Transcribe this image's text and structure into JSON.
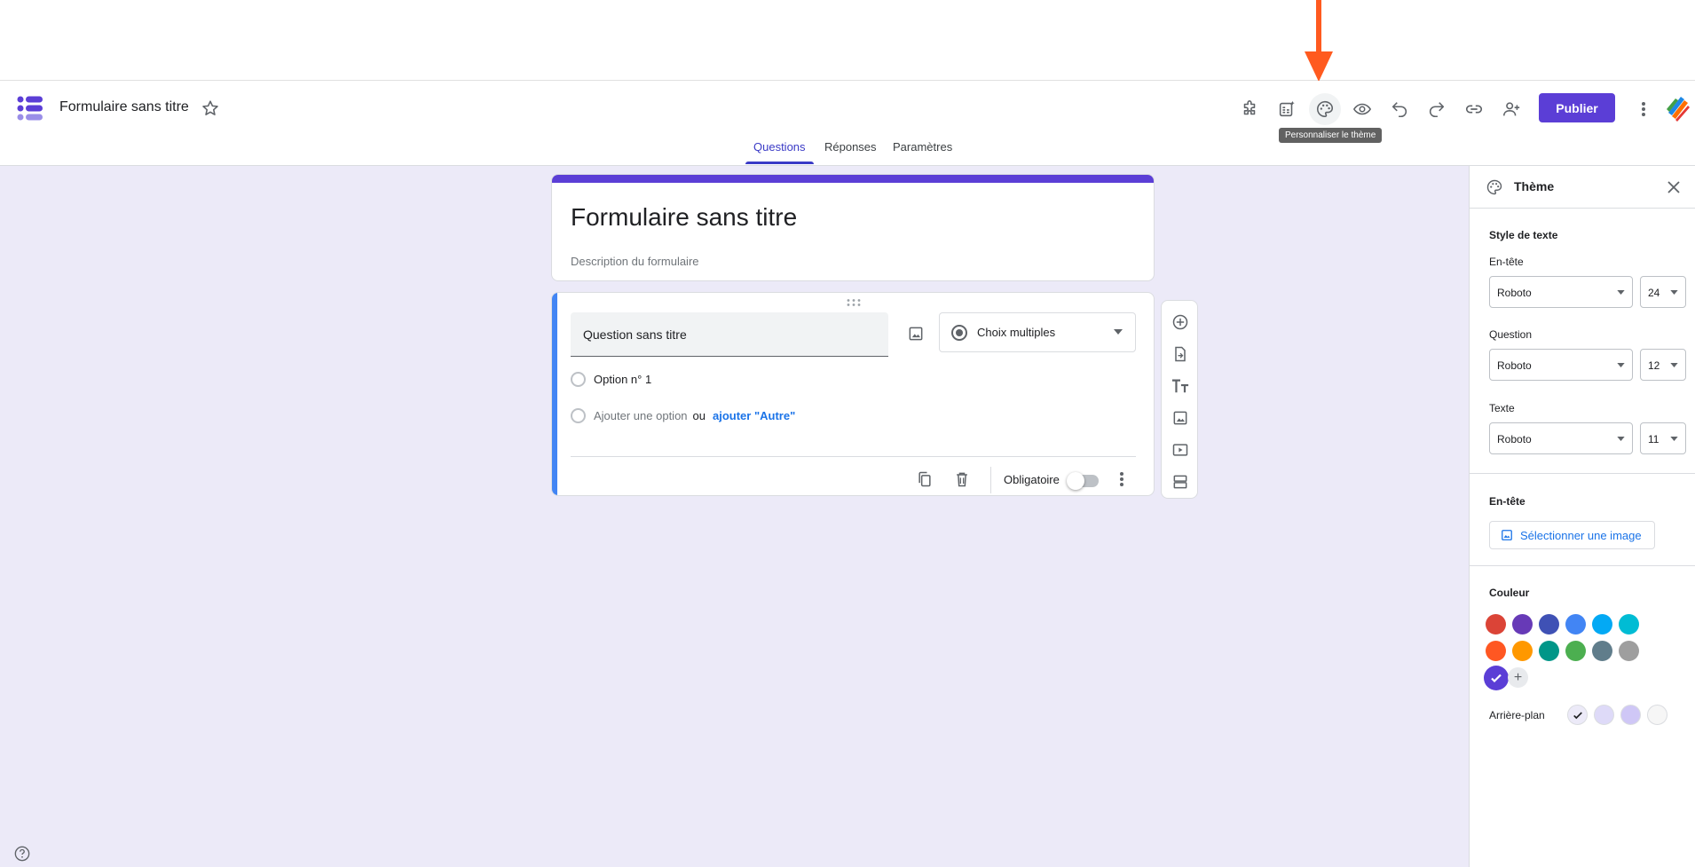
{
  "header": {
    "doc_title": "Formulaire sans titre",
    "tooltip": "Personnaliser le thème",
    "publish_label": "Publier",
    "tabs": [
      {
        "label": "Questions"
      },
      {
        "label": "Réponses"
      },
      {
        "label": "Paramètres"
      }
    ],
    "icons": [
      "addons-icon",
      "ai-icon",
      "palette-icon",
      "preview-icon",
      "undo-icon",
      "redo-icon",
      "link-icon",
      "add-person-icon",
      "more-icon"
    ]
  },
  "form": {
    "title": "Formulaire sans titre",
    "description": "Description du formulaire"
  },
  "question": {
    "title": "Question sans titre",
    "type": "Choix multiples",
    "options": [
      "Option n° 1"
    ],
    "add_option": "Ajouter une option",
    "or_text": "ou",
    "add_other": "ajouter \"Autre\"",
    "required_label": "Obligatoire"
  },
  "theme_panel": {
    "title": "Thème",
    "text_style_title": "Style de texte",
    "header_label": "En-tête",
    "header_font": "Roboto",
    "header_size": "24",
    "question_label": "Question",
    "question_font": "Roboto",
    "question_size": "12",
    "text_label": "Texte",
    "text_font": "Roboto",
    "text_size": "11",
    "header_section_title": "En-tête",
    "select_image": "Sélectionner une image",
    "color_title": "Couleur",
    "colors": [
      "#db4437",
      "#673ab7",
      "#3f51b5",
      "#4285f4",
      "#03a9f4",
      "#00bcd4",
      "#ff5722",
      "#ff9800",
      "#009688",
      "#4caf50",
      "#607d8b",
      "#9e9e9e",
      "#5b3ed6"
    ],
    "selected_color": "#5b3ed6",
    "background_label": "Arrière-plan",
    "backgrounds": [
      "#eceaf8",
      "#dedaf8",
      "#cfc7f6",
      "#f6f6f6"
    ]
  },
  "accent": "#5b3ed6"
}
